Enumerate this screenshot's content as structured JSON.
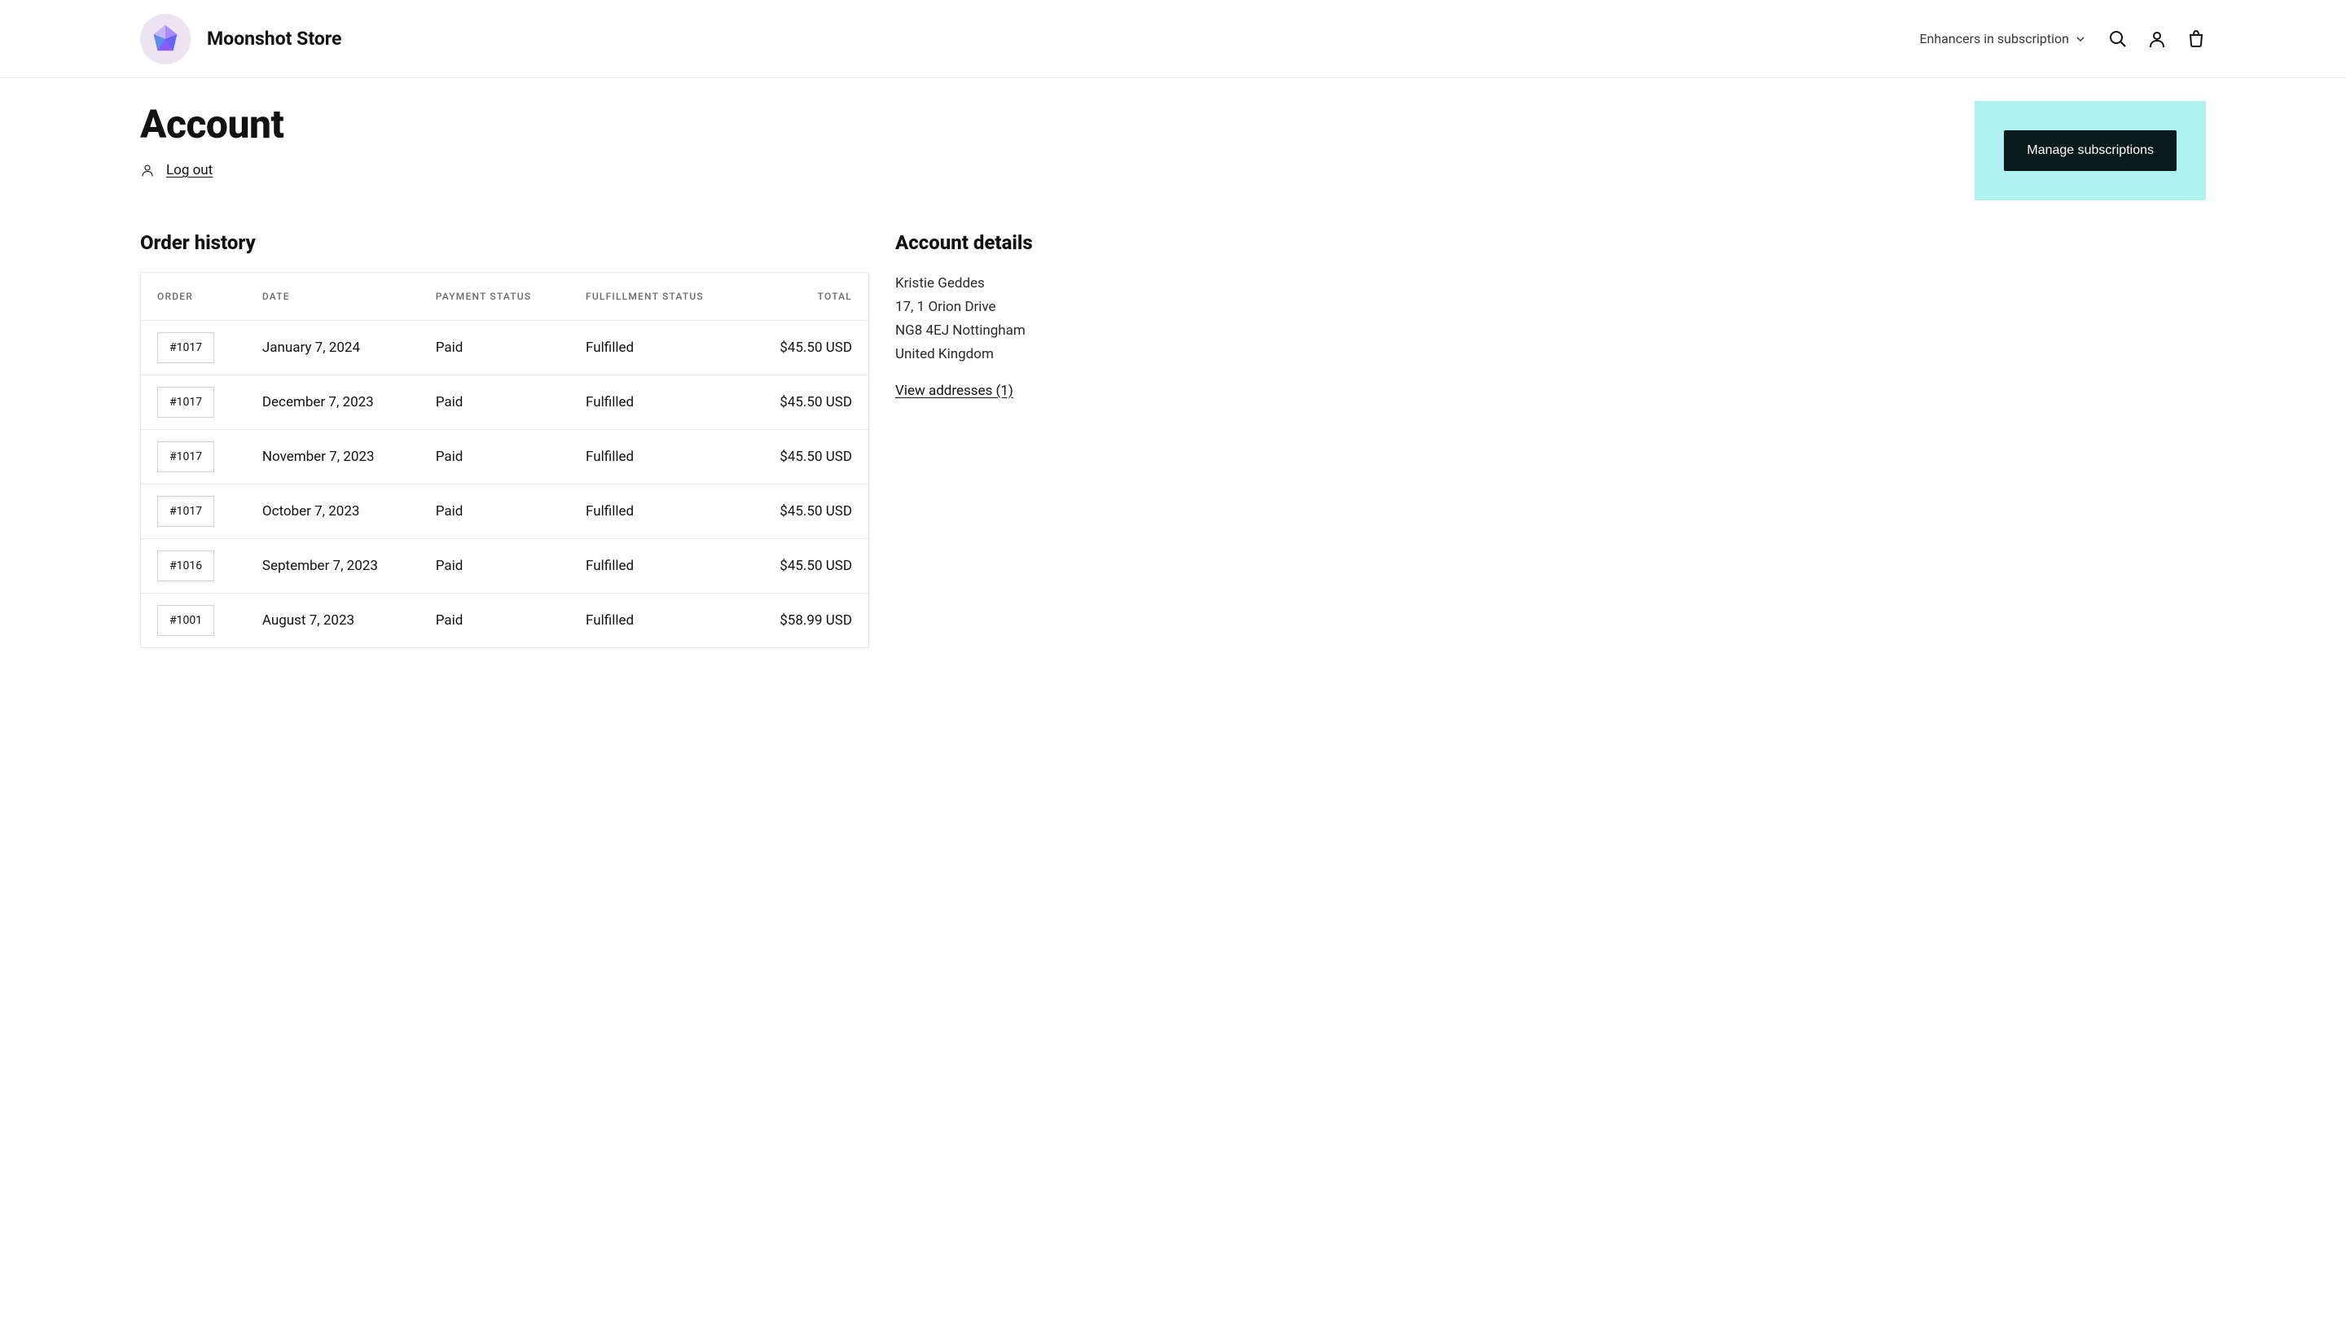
{
  "header": {
    "store_name": "Moonshot Store",
    "nav_link": "Enhancers in subscription"
  },
  "page": {
    "title": "Account",
    "logout": "Log out"
  },
  "subscription": {
    "manage_label": "Manage subscriptions"
  },
  "order_history": {
    "title": "Order history",
    "columns": {
      "order": "ORDER",
      "date": "DATE",
      "payment_status": "PAYMENT STATUS",
      "fulfillment_status": "FULFILLMENT STATUS",
      "total": "TOTAL"
    },
    "rows": [
      {
        "order": "#1017",
        "date": "January 7, 2024",
        "payment": "Paid",
        "fulfillment": "Fulfilled",
        "total": "$45.50 USD"
      },
      {
        "order": "#1017",
        "date": "December 7, 2023",
        "payment": "Paid",
        "fulfillment": "Fulfilled",
        "total": "$45.50 USD"
      },
      {
        "order": "#1017",
        "date": "November 7, 2023",
        "payment": "Paid",
        "fulfillment": "Fulfilled",
        "total": "$45.50 USD"
      },
      {
        "order": "#1017",
        "date": "October 7, 2023",
        "payment": "Paid",
        "fulfillment": "Fulfilled",
        "total": "$45.50 USD"
      },
      {
        "order": "#1016",
        "date": "September 7, 2023",
        "payment": "Paid",
        "fulfillment": "Fulfilled",
        "total": "$45.50 USD"
      },
      {
        "order": "#1001",
        "date": "August 7, 2023",
        "payment": "Paid",
        "fulfillment": "Fulfilled",
        "total": "$58.99 USD"
      }
    ]
  },
  "account_details": {
    "title": "Account details",
    "name": "Kristie Geddes",
    "line1": "17, 1 Orion Drive",
    "line2": "NG8 4EJ Nottingham",
    "country": "United Kingdom",
    "view_addresses": "View addresses (1)"
  }
}
